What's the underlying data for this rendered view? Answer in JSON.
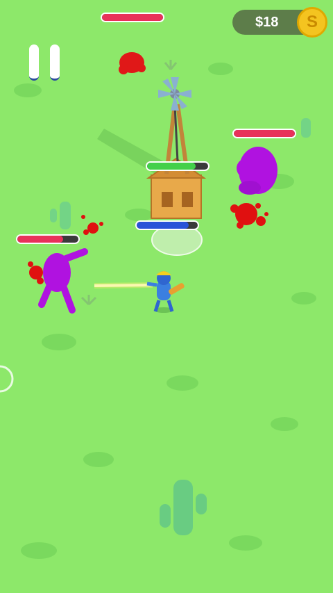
{
  "hud": {
    "pause_icon": "pause-icon",
    "money_label": "$18",
    "coin_icon": "coin-icon",
    "coin_glyph": "S"
  },
  "colors": {
    "grass": "#8de86a",
    "enemy_health": "#e8325a",
    "tower_health": "#43d04a",
    "player_bar": "#2a52d8",
    "enemy": "#b012e0",
    "blood": "#e01010"
  },
  "health": {
    "top_enemy": 1.0,
    "right_enemy": 1.0,
    "left_enemy": 0.75,
    "tower": 0.8,
    "player_bar": 0.85
  }
}
